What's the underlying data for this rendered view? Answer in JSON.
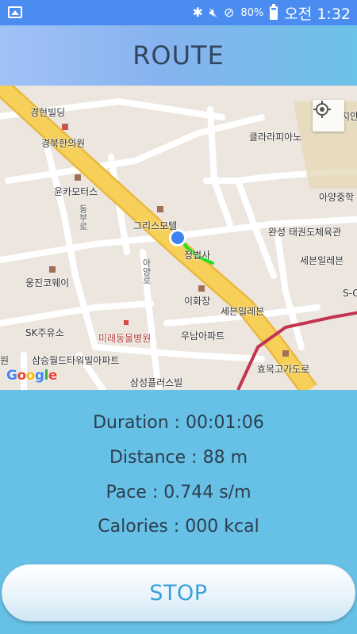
{
  "status_bar": {
    "battery_percent": "80%",
    "time": "오전 1:32",
    "icons": [
      "gallery-icon",
      "bluetooth-icon",
      "mute-icon",
      "do-not-disturb-icon",
      "battery-icon"
    ]
  },
  "header": {
    "title": "ROUTE"
  },
  "map": {
    "labels": {
      "l1": "경현빌딩",
      "l2": "경북한의원",
      "l3": "윤카모터스",
      "l4": "클라라피아노",
      "l5": "아양중학",
      "l6": "그리스모텔",
      "l7": "완성 태권도체육관",
      "l8": "정법사",
      "l9": "세븐일레븐",
      "l10": "웅진코웨이",
      "l11": "이화장",
      "l12": "세븐일레븐",
      "l13": "SK주유소",
      "l14": "미래동물병원",
      "l15": "우남아파트",
      "l16": "삼승월드타워빌아파트",
      "l17": "효목고가도로",
      "l18": "삼성플러스빌",
      "l19": "지안",
      "l20": "S-O",
      "l21": "원",
      "l22": "동부로",
      "l23": "아양로"
    },
    "google_logo": "Google",
    "colors": {
      "main_road": "#f7d05a",
      "route": "#21e21e",
      "rail": "#c2344f",
      "location": "#3d82f0"
    }
  },
  "stats": {
    "duration": "Duration : 00:01:06",
    "distance": "Distance : 88 m",
    "pace": "Pace : 0.744 s/m",
    "calories": "Calories : 000 kcal"
  },
  "stop_button": {
    "label": "STOP"
  }
}
